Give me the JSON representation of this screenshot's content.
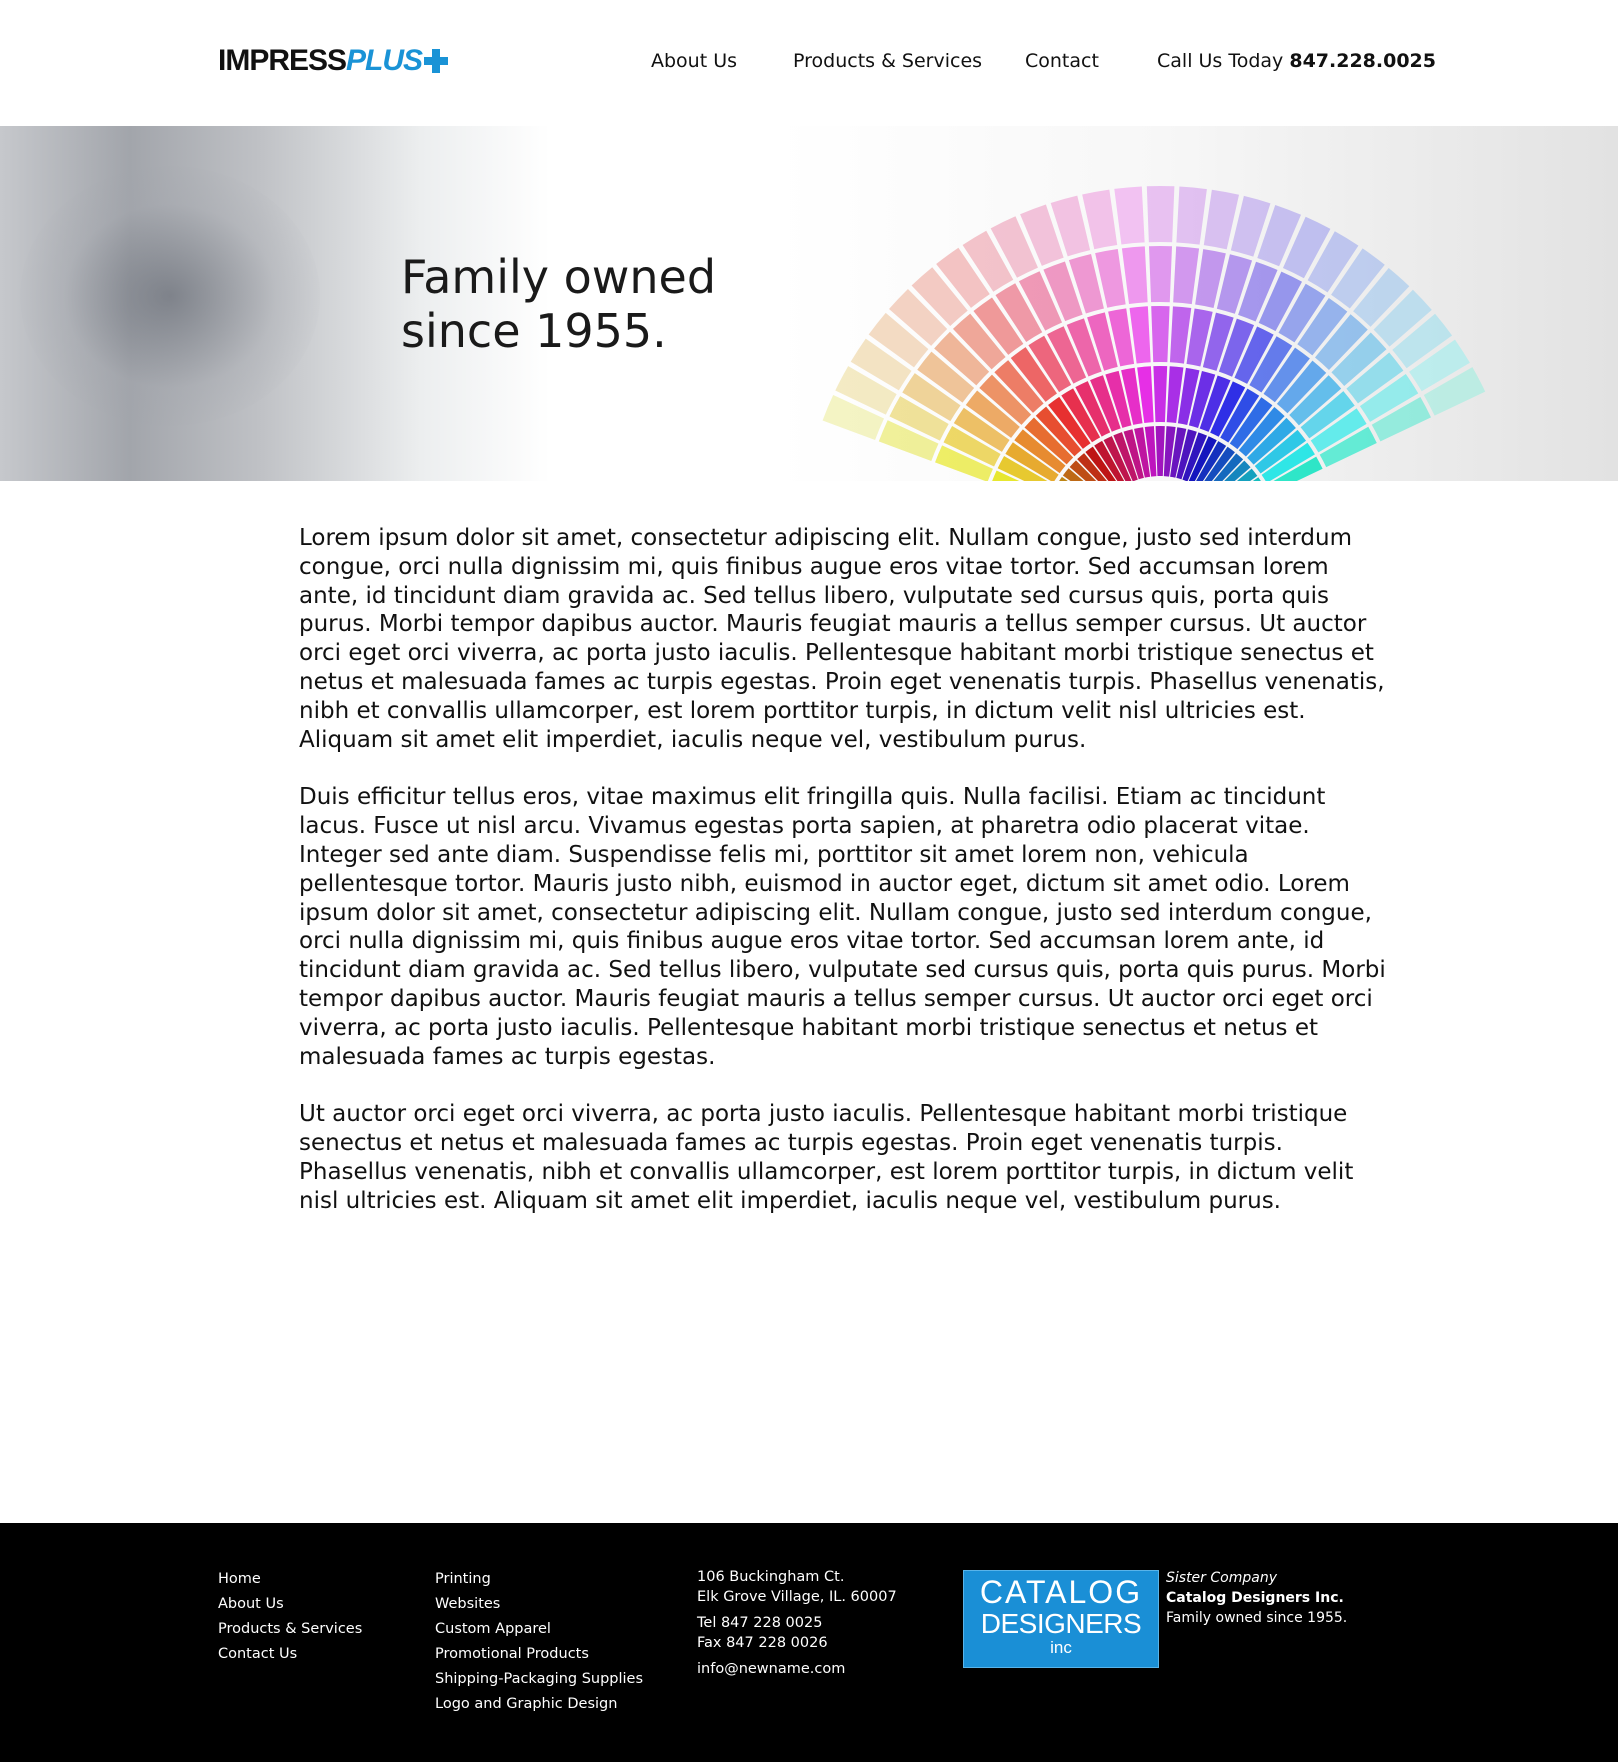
{
  "header": {
    "logo": {
      "word1": "IMPRESS",
      "word2": "PLUS"
    },
    "nav": {
      "about": "About Us",
      "products": "Products & Services",
      "contact": "Contact"
    },
    "call": {
      "label": "Call Us Today",
      "phone": "847.228.0025"
    }
  },
  "hero": {
    "title": "Family owned since 1955."
  },
  "content": {
    "paragraphs": [
      "Lorem ipsum dolor sit amet, consectetur adipiscing elit. Nullam congue, justo sed interdum congue, orci nulla dignissim mi, quis finibus augue eros vitae tortor. Sed accumsan lorem ante, id tincidunt diam gravida ac. Sed tellus libero, vulputate sed cursus quis, porta quis purus. Morbi tempor dapibus auctor. Mauris feugiat mauris a tellus semper cursus. Ut auctor orci eget orci viverra, ac porta justo iaculis. Pellentesque habitant morbi tristique senectus et netus et malesuada fames ac turpis egestas. Proin eget venenatis turpis. Phasellus venenatis, nibh et convallis ullamcorper, est lorem porttitor turpis, in dictum velit nisl ultricies est. Aliquam sit amet elit imperdiet, iaculis neque vel, vestibulum purus.",
      "Duis efficitur tellus eros, vitae maximus elit fringilla quis. Nulla facilisi. Etiam ac tincidunt lacus. Fusce ut nisl arcu. Vivamus egestas porta sapien, at pharetra odio placerat vitae. Integer sed ante diam. Suspendisse felis mi, porttitor sit amet lorem non, vehicula pellentesque tortor. Mauris justo nibh, euismod in auctor eget, dictum sit amet odio. Lorem ipsum dolor sit amet, consectetur adipiscing elit. Nullam congue, justo sed interdum congue, orci nulla dignissim mi, quis finibus augue eros vitae tortor. Sed accumsan lorem ante, id tincidunt diam gravida ac. Sed tellus libero, vulputate sed cursus quis, porta quis purus. Morbi tempor dapibus auctor. Mauris feugiat mauris a tellus semper cursus. Ut auctor orci eget orci viverra, ac porta justo iaculis. Pellentesque habitant morbi tristique senectus et netus et malesuada fames ac turpis egestas.",
      "Ut auctor orci eget orci viverra, ac porta justo iaculis. Pellentesque habitant morbi tristique senectus et netus et malesuada fames ac turpis egestas. Proin eget venenatis turpis. Phasellus venenatis, nibh et convallis ullamcorper, est lorem porttitor turpis, in dictum velit nisl ultricies est. Aliquam sit amet elit imperdiet, iaculis neque vel, vestibulum purus."
    ]
  },
  "footer": {
    "nav": [
      "Home",
      "About Us",
      "Products & Services",
      "Contact Us"
    ],
    "services": [
      "Printing",
      "Websites",
      "Custom Apparel",
      "Promotional Products",
      "Shipping-Packaging Supplies",
      "Logo and Graphic Design"
    ],
    "address": {
      "street": "106 Buckingham Ct.",
      "city": "Elk Grove Village, IL. 60007",
      "tel": "Tel 847 228 0025",
      "fax": "Fax 847 228 0026",
      "email": "info@newname.com"
    },
    "sister_logo": {
      "line1": "CATALOG",
      "line2": "DESIGNERS",
      "line3": "inc"
    },
    "sister": {
      "label": "Sister Company",
      "name": "Catalog Designers Inc.",
      "tagline": "Family owned since 1955."
    }
  },
  "colors": {
    "brand_blue": "#1a93d6",
    "footer_bg": "#000000",
    "sister_logo_bg": "#1a8fd6"
  }
}
